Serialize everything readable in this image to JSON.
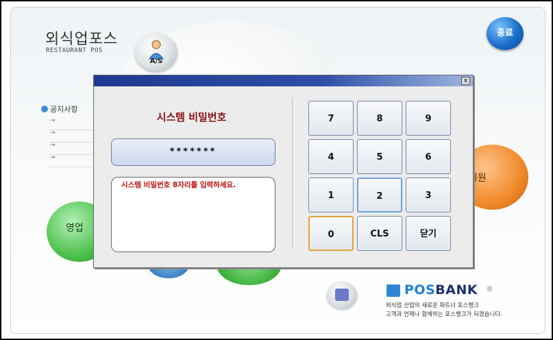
{
  "app": {
    "title": "외식업포스",
    "subtitle": "RESTAURANT POS",
    "as_button": "A/S",
    "exit_button": "종료"
  },
  "notice": {
    "heading": "공지사항",
    "rows": [
      "→",
      "→",
      "→",
      "→"
    ]
  },
  "menu": {
    "member": "회원",
    "sales": "영업"
  },
  "brand": {
    "name_part1": "POS",
    "name_part2": "BANK",
    "reg": "®",
    "line1": "외식업 산업의 새로운 파트너 포스뱅크",
    "line2": "고객과 언제나 함께하는 포스뱅크가 되겠습니다."
  },
  "dialog": {
    "close": "x",
    "title": "시스템 비밀번호",
    "password_mask": "*******",
    "message": "시스템 비밀번호 8자리를 입력하세요.",
    "keys": [
      "7",
      "8",
      "9",
      "4",
      "5",
      "6",
      "1",
      "2",
      "3",
      "0",
      "CLS",
      "닫기"
    ]
  },
  "icons": {
    "as": "support-person-icon",
    "keyboard": "keyboard-icon",
    "brand": "posbank-logo-icon",
    "notice": "bullet-circle-icon"
  },
  "colors": {
    "exit": "#1b6fcb",
    "member": "#f08a2a",
    "sales": "#4cc14c",
    "dialog_title": "#8b1010",
    "message": "#c01010",
    "brand": "#1d7fd0"
  }
}
